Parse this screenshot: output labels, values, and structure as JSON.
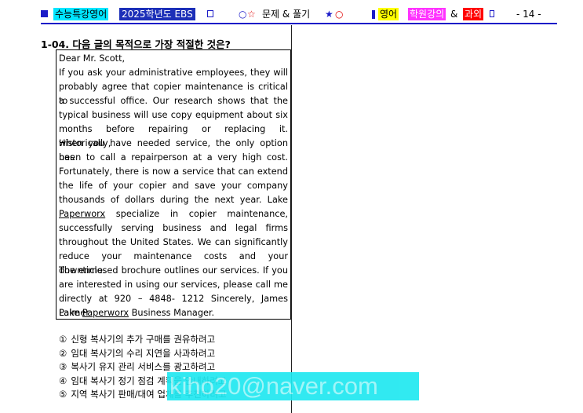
{
  "header": {
    "tag1": "수능특강영어",
    "tag2": "2025학년도 EBS",
    "title": "문제 & 풀기",
    "tag_english": "영어",
    "tag_academy": "학원강의",
    "amp": "&",
    "tag_tutor": "과외",
    "page": "- 14 -",
    "glyph_circle": "○",
    "glyph_star_outline": "☆",
    "glyph_star_filled": "★",
    "glyph_circle_end": "○",
    "accent_color": "#1c1cc8"
  },
  "question": "1-04. 다음 글의 목적으로 가장 적절한 것은?",
  "passage": {
    "lines": [
      "Dear Mr. Scott,",
      "If you ask your administrative employees, they will",
      "probably agree that copier maintenance is critical to",
      "a successful office. Our research shows that the",
      "typical business will use copy equipment about six",
      "months before repairing or replacing it. Historically,",
      "when you have needed service, the only option has",
      "been to call a repairperson at a very high cost.",
      "Fortunately, there is now a service that can extend",
      "the life of your copier and save your company",
      "thousands of dollars during the next year. Lake",
      "Paperworx specialize in copier maintenance,",
      "successfully serving business and legal firms",
      "throughout the United States. We can significantly",
      "reduce your maintenance costs and your downtime.",
      "The enclosed brochure outlines our services. If you",
      "are interested in using our services, please call me",
      "directly at 920 – 4848- 1212 Sincerely, James Palmer",
      "Lake Paperworx Business Manager."
    ]
  },
  "choices": [
    {
      "num": "①",
      "text": "신형 복사기의 추가 구매를 권유하려고"
    },
    {
      "num": "②",
      "text": "임대 복사기의 수리 지연을 사과하려고"
    },
    {
      "num": "③",
      "text": "복사기 유지 관리 서비스를 광고하려고"
    },
    {
      "num": "④",
      "text": "임대 복사기 정기 점검 계획을 안내하려고"
    },
    {
      "num": "⑤",
      "text": "지역 복사기 판매/대여 업체를 추천하려고"
    }
  ],
  "watermark": "kiho20@naver.com"
}
